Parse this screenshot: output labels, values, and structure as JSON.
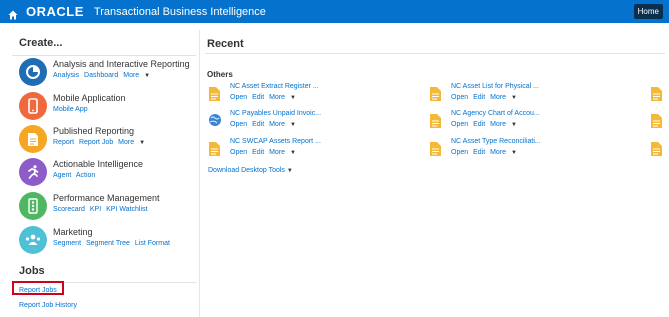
{
  "header": {
    "brand": "ORACLE",
    "app_title": "Transactional Business Intelligence",
    "home_button": "Home"
  },
  "create": {
    "heading": "Create...",
    "items": [
      {
        "title": "Analysis and Interactive Reporting",
        "links": [
          "Analysis",
          "Dashboard",
          "More"
        ],
        "icon": "analysis-icon",
        "color": "#1e6db5"
      },
      {
        "title": "Mobile Application",
        "links": [
          "Mobile App"
        ],
        "icon": "mobile-icon",
        "color": "#f0683e"
      },
      {
        "title": "Published Reporting",
        "links": [
          "Report",
          "Report Job",
          "More"
        ],
        "icon": "report-icon",
        "color": "#f5a623"
      },
      {
        "title": "Actionable Intelligence",
        "links": [
          "Agent",
          "Action"
        ],
        "icon": "runner-icon",
        "color": "#8e5cc9"
      },
      {
        "title": "Performance Management",
        "links": [
          "Scorecard",
          "KPI",
          "KPI Watchlist"
        ],
        "icon": "scorecard-icon",
        "color": "#4fb664"
      },
      {
        "title": "Marketing",
        "links": [
          "Segment",
          "Segment Tree",
          "List Format"
        ],
        "icon": "people-icon",
        "color": "#4fc1d6"
      }
    ]
  },
  "jobs": {
    "heading": "Jobs",
    "links": [
      "Report Jobs",
      "Report Job History"
    ]
  },
  "recent": {
    "heading": "Recent",
    "group": "Others",
    "item_links": [
      "Open",
      "Edit",
      "More"
    ],
    "items": [
      {
        "title": "NC Asset Extract Register ...",
        "icon": "document-icon"
      },
      {
        "title": "NC Asset List for Physical ...",
        "icon": "document-icon"
      },
      {
        "title": "NC Payables Unpaid Invoic...",
        "icon": "globe-icon"
      },
      {
        "title": "NC Agency Chart of Accou...",
        "icon": "document-icon"
      },
      {
        "title": "NC SWCAP Assets Report ...",
        "icon": "document-icon"
      },
      {
        "title": "NC Asset Type Reconciliati...",
        "icon": "document-icon"
      }
    ],
    "download": "Download Desktop Tools"
  }
}
